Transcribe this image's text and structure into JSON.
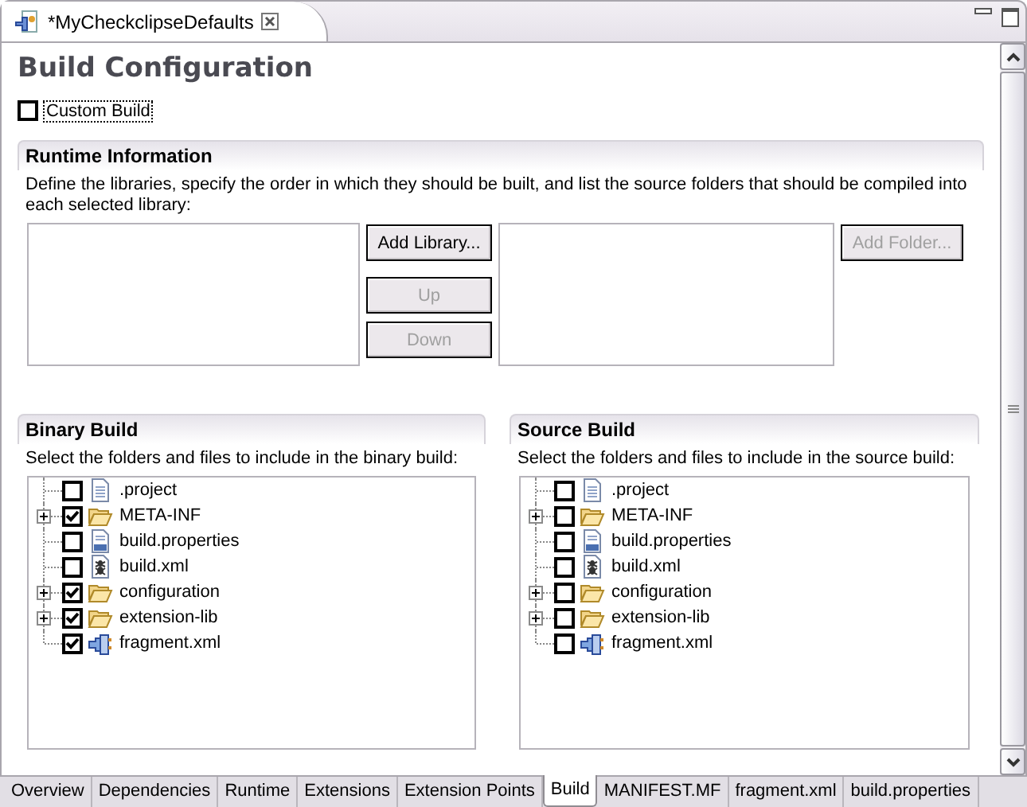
{
  "editor_tab": {
    "title": "*MyCheckclipseDefaults",
    "selected": true
  },
  "page": {
    "title": "Build Configuration",
    "custom_build": {
      "label": "Custom Build",
      "checked": false
    }
  },
  "runtime": {
    "title": "Runtime Information",
    "description": "Define the libraries, specify the order in which they should be built, and list the source folders that should be compiled into each selected library:",
    "library_buttons": [
      {
        "label": "Add Library...",
        "disabled": false
      },
      {
        "label": "Up",
        "disabled": true
      },
      {
        "label": "Down",
        "disabled": true
      }
    ],
    "folder_buttons": [
      {
        "label": "Add Folder...",
        "disabled": true
      }
    ]
  },
  "binary_build": {
    "title": "Binary Build",
    "description": "Select the folders and files to include in the binary build:",
    "tree": [
      {
        "label": ".project",
        "kind": "file",
        "expandable": false,
        "checked": false
      },
      {
        "label": "META-INF",
        "kind": "folder",
        "expandable": true,
        "checked": true
      },
      {
        "label": "build.properties",
        "kind": "properties",
        "expandable": false,
        "checked": false
      },
      {
        "label": "build.xml",
        "kind": "ant",
        "expandable": false,
        "checked": false
      },
      {
        "label": "configuration",
        "kind": "folder",
        "expandable": true,
        "checked": true
      },
      {
        "label": "extension-lib",
        "kind": "folder",
        "expandable": true,
        "checked": true
      },
      {
        "label": "fragment.xml",
        "kind": "fragment",
        "expandable": false,
        "checked": true
      }
    ]
  },
  "source_build": {
    "title": "Source Build",
    "description": "Select the folders and files to include in the source build:",
    "tree": [
      {
        "label": ".project",
        "kind": "file",
        "expandable": false,
        "checked": false
      },
      {
        "label": "META-INF",
        "kind": "folder",
        "expandable": true,
        "checked": false
      },
      {
        "label": "build.properties",
        "kind": "properties",
        "expandable": false,
        "checked": false
      },
      {
        "label": "build.xml",
        "kind": "ant",
        "expandable": false,
        "checked": false
      },
      {
        "label": "configuration",
        "kind": "folder",
        "expandable": true,
        "checked": false
      },
      {
        "label": "extension-lib",
        "kind": "folder",
        "expandable": true,
        "checked": false
      },
      {
        "label": "fragment.xml",
        "kind": "fragment",
        "expandable": false,
        "checked": false
      }
    ]
  },
  "page_tabs": [
    {
      "label": "Overview",
      "selected": false
    },
    {
      "label": "Dependencies",
      "selected": false
    },
    {
      "label": "Runtime",
      "selected": false
    },
    {
      "label": "Extensions",
      "selected": false
    },
    {
      "label": "Extension Points",
      "selected": false
    },
    {
      "label": "Build",
      "selected": true
    },
    {
      "label": "MANIFEST.MF",
      "selected": false
    },
    {
      "label": "fragment.xml",
      "selected": false
    },
    {
      "label": "build.properties",
      "selected": false
    }
  ]
}
